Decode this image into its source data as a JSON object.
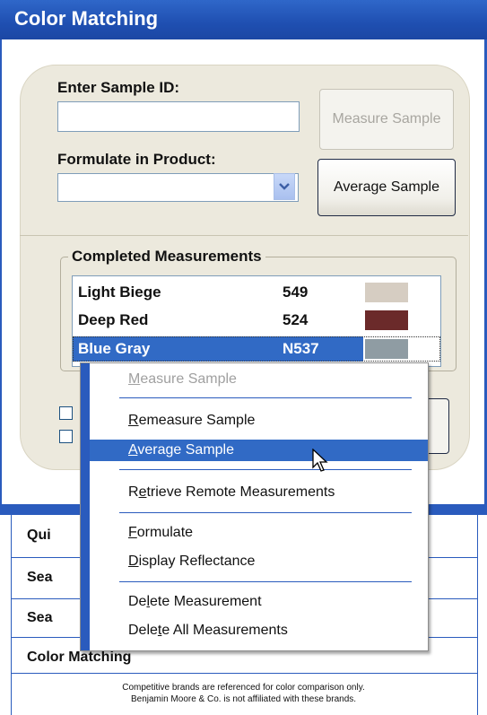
{
  "window": {
    "title": "Color Matching"
  },
  "form": {
    "sample_id_label": "Enter Sample ID:",
    "sample_id_value": "",
    "formulate_label": "Formulate in Product:",
    "formulate_value": "",
    "measure_button": "Measure Sample",
    "average_button": "Average Sample"
  },
  "completed": {
    "title": "Completed Measurements",
    "items": [
      {
        "name": "Light Biege",
        "code": "549",
        "color": "#d6cdc2"
      },
      {
        "name": "Deep Red",
        "code": "524",
        "color": "#6b2a2a"
      },
      {
        "name": "Blue Gray",
        "code": "N537",
        "color": "#8f9ca3"
      }
    ]
  },
  "context_menu": {
    "items": [
      {
        "label": "Measure Sample",
        "mnemonic": "M",
        "state": "disabled"
      },
      {
        "label": "Remeasure Sample",
        "mnemonic": "R",
        "state": "normal"
      },
      {
        "label": "Average Sample",
        "mnemonic": "A",
        "state": "highlighted"
      },
      {
        "label": "Retrieve Remote Measurements",
        "mnemonic": "e",
        "state": "normal"
      },
      {
        "label": "Formulate",
        "mnemonic": "F",
        "state": "normal"
      },
      {
        "label": "Display Reflectance",
        "mnemonic": "D",
        "state": "normal"
      },
      {
        "label": "Delete Measurement",
        "mnemonic": "l",
        "state": "normal"
      },
      {
        "label": "Delete All Measurements",
        "mnemonic": "t",
        "state": "normal"
      }
    ]
  },
  "bottom_nav": {
    "items": [
      "Qui",
      "Sea",
      "Sea",
      "Color Matching"
    ]
  },
  "footer": {
    "line1": "Competitive brands are referenced for color comparison only.",
    "line2": "Benjamin Moore & Co. is not affiliated with these brands."
  },
  "icons": {
    "dropdown": "chevron-down-icon",
    "pointer": "mouse-cursor-icon"
  },
  "colors": {
    "accent": "#2a5bbd",
    "selection": "#316ac5",
    "panel": "#ece9dd"
  }
}
